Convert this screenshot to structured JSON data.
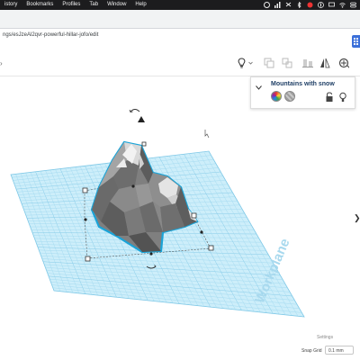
{
  "menubar": {
    "items": [
      "istory",
      "Bookmarks",
      "Profiles",
      "Tab",
      "Window",
      "Help"
    ]
  },
  "browser": {
    "url": "ngs/esJzeAl2qvr-powerful-hillar-jofo/edit"
  },
  "toolbar": {
    "left_glyph": "›"
  },
  "shape_panel": {
    "title": "Mountains with snow",
    "collapse_glyph": "❯"
  },
  "workplane": {
    "label": "Workplane",
    "grid_color": "#8fd0ec",
    "bg_color": "#cdeefa",
    "selection_color": "#1aa4d8"
  },
  "footer": {
    "settings_label": "Settings",
    "snap_grid_label": "Snap Grid",
    "snap_grid_value": "0.1 mm"
  },
  "icons": {
    "menubar_tray": [
      "creative-cloud-icon",
      "wifi-bars-icon",
      "dropbox-icon",
      "bluetooth-icon",
      "record-icon",
      "onepassword-icon",
      "display-icon",
      "wifi-icon",
      "control-center-icon"
    ],
    "toolbar": [
      "lightbulb-icon",
      "group-icon",
      "ungroup-icon",
      "align-icon",
      "mirror-icon",
      "cruise-icon"
    ]
  }
}
